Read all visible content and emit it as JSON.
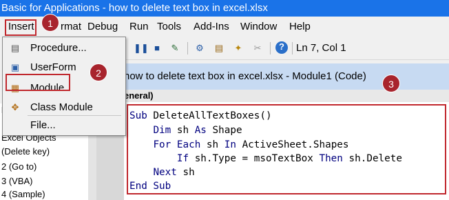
{
  "window": {
    "title": "Basic for Applications - how to delete text box in excel.xlsx"
  },
  "menubar": {
    "items": [
      {
        "label": "Insert"
      },
      {
        "label": "Format",
        "visible_fragment": "rmat"
      },
      {
        "label": "Debug"
      },
      {
        "label": "Run"
      },
      {
        "label": "Tools"
      },
      {
        "label": "Add-Ins"
      },
      {
        "label": "Window"
      },
      {
        "label": "Help"
      }
    ]
  },
  "toolbar": {
    "cursor_position": "Ln 7, Col 1"
  },
  "insert_menu": {
    "items": [
      {
        "label": "Procedure...",
        "icon": "procedure-icon"
      },
      {
        "label": "UserForm",
        "icon": "userform-icon"
      },
      {
        "label": "Module",
        "icon": "module-icon"
      },
      {
        "label": "Class Module",
        "icon": "class-module-icon"
      },
      {
        "label": "File...",
        "icon": ""
      }
    ]
  },
  "code_window": {
    "title": "how to delete text box in excel.xlsx - Module1 (Code)",
    "object_selector": "eneral)",
    "lines": [
      {
        "kw1": "Sub",
        "text": " DeleteAllTextBoxes()"
      },
      {
        "indent": "    ",
        "kw1": "Dim",
        "mid": " sh ",
        "kw2": "As",
        "text": " Shape"
      },
      {
        "indent": "    ",
        "kw1": "For Each",
        "mid": " sh ",
        "kw2": "In",
        "text": " ActiveSheet.Shapes"
      },
      {
        "indent": "        ",
        "kw1": "If",
        "mid": " sh.Type = msoTextBox ",
        "kw2": "Then",
        "text": " sh.Delete"
      },
      {
        "indent": "    ",
        "kw1": "Next",
        "text": " sh"
      },
      {
        "kw1": "End Sub",
        "text": ""
      }
    ]
  },
  "project_tree": {
    "items": [
      "F",
      "Excel Objects",
      "(Delete key)",
      "2 (Go to)",
      "3 (VBA)",
      "4 (Sample)"
    ]
  },
  "badges": [
    "1",
    "2",
    "3"
  ],
  "colors": {
    "title_bar": "#1a73e8",
    "highlight": "#c0272d",
    "badge": "#a8242d",
    "keyword": "#00007f"
  }
}
